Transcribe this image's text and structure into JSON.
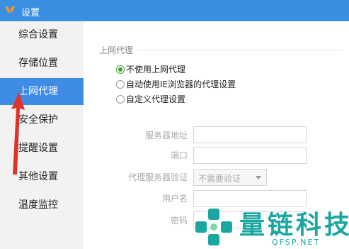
{
  "window": {
    "title": "设置"
  },
  "sidebar": {
    "items": [
      {
        "label": "综合设置"
      },
      {
        "label": "存储位置"
      },
      {
        "label": "上网代理"
      },
      {
        "label": "安全保护"
      },
      {
        "label": "提醒设置"
      },
      {
        "label": "其他设置"
      },
      {
        "label": "温度监控"
      }
    ]
  },
  "proxy": {
    "section_title": "上网代理",
    "options": [
      {
        "label": "不使用上网代理",
        "checked": true
      },
      {
        "label": "自动使用IE浏览器的代理设置",
        "checked": false
      },
      {
        "label": "自定义代理设置",
        "checked": false
      }
    ],
    "fields": {
      "server_label": "服务器地址",
      "port_label": "端口",
      "auth_label": "代理服务器验证",
      "auth_value": "不需要验证",
      "username_label": "用户名",
      "password_label": "密码"
    }
  },
  "watermark": {
    "text": "量链科技",
    "sub": "QFSP.NET"
  },
  "colors": {
    "titlebar": "#3b8fe3",
    "active_item": "#3f8ce6",
    "annotation_arrow": "#e0322b",
    "watermark": "#1aa7a0"
  }
}
